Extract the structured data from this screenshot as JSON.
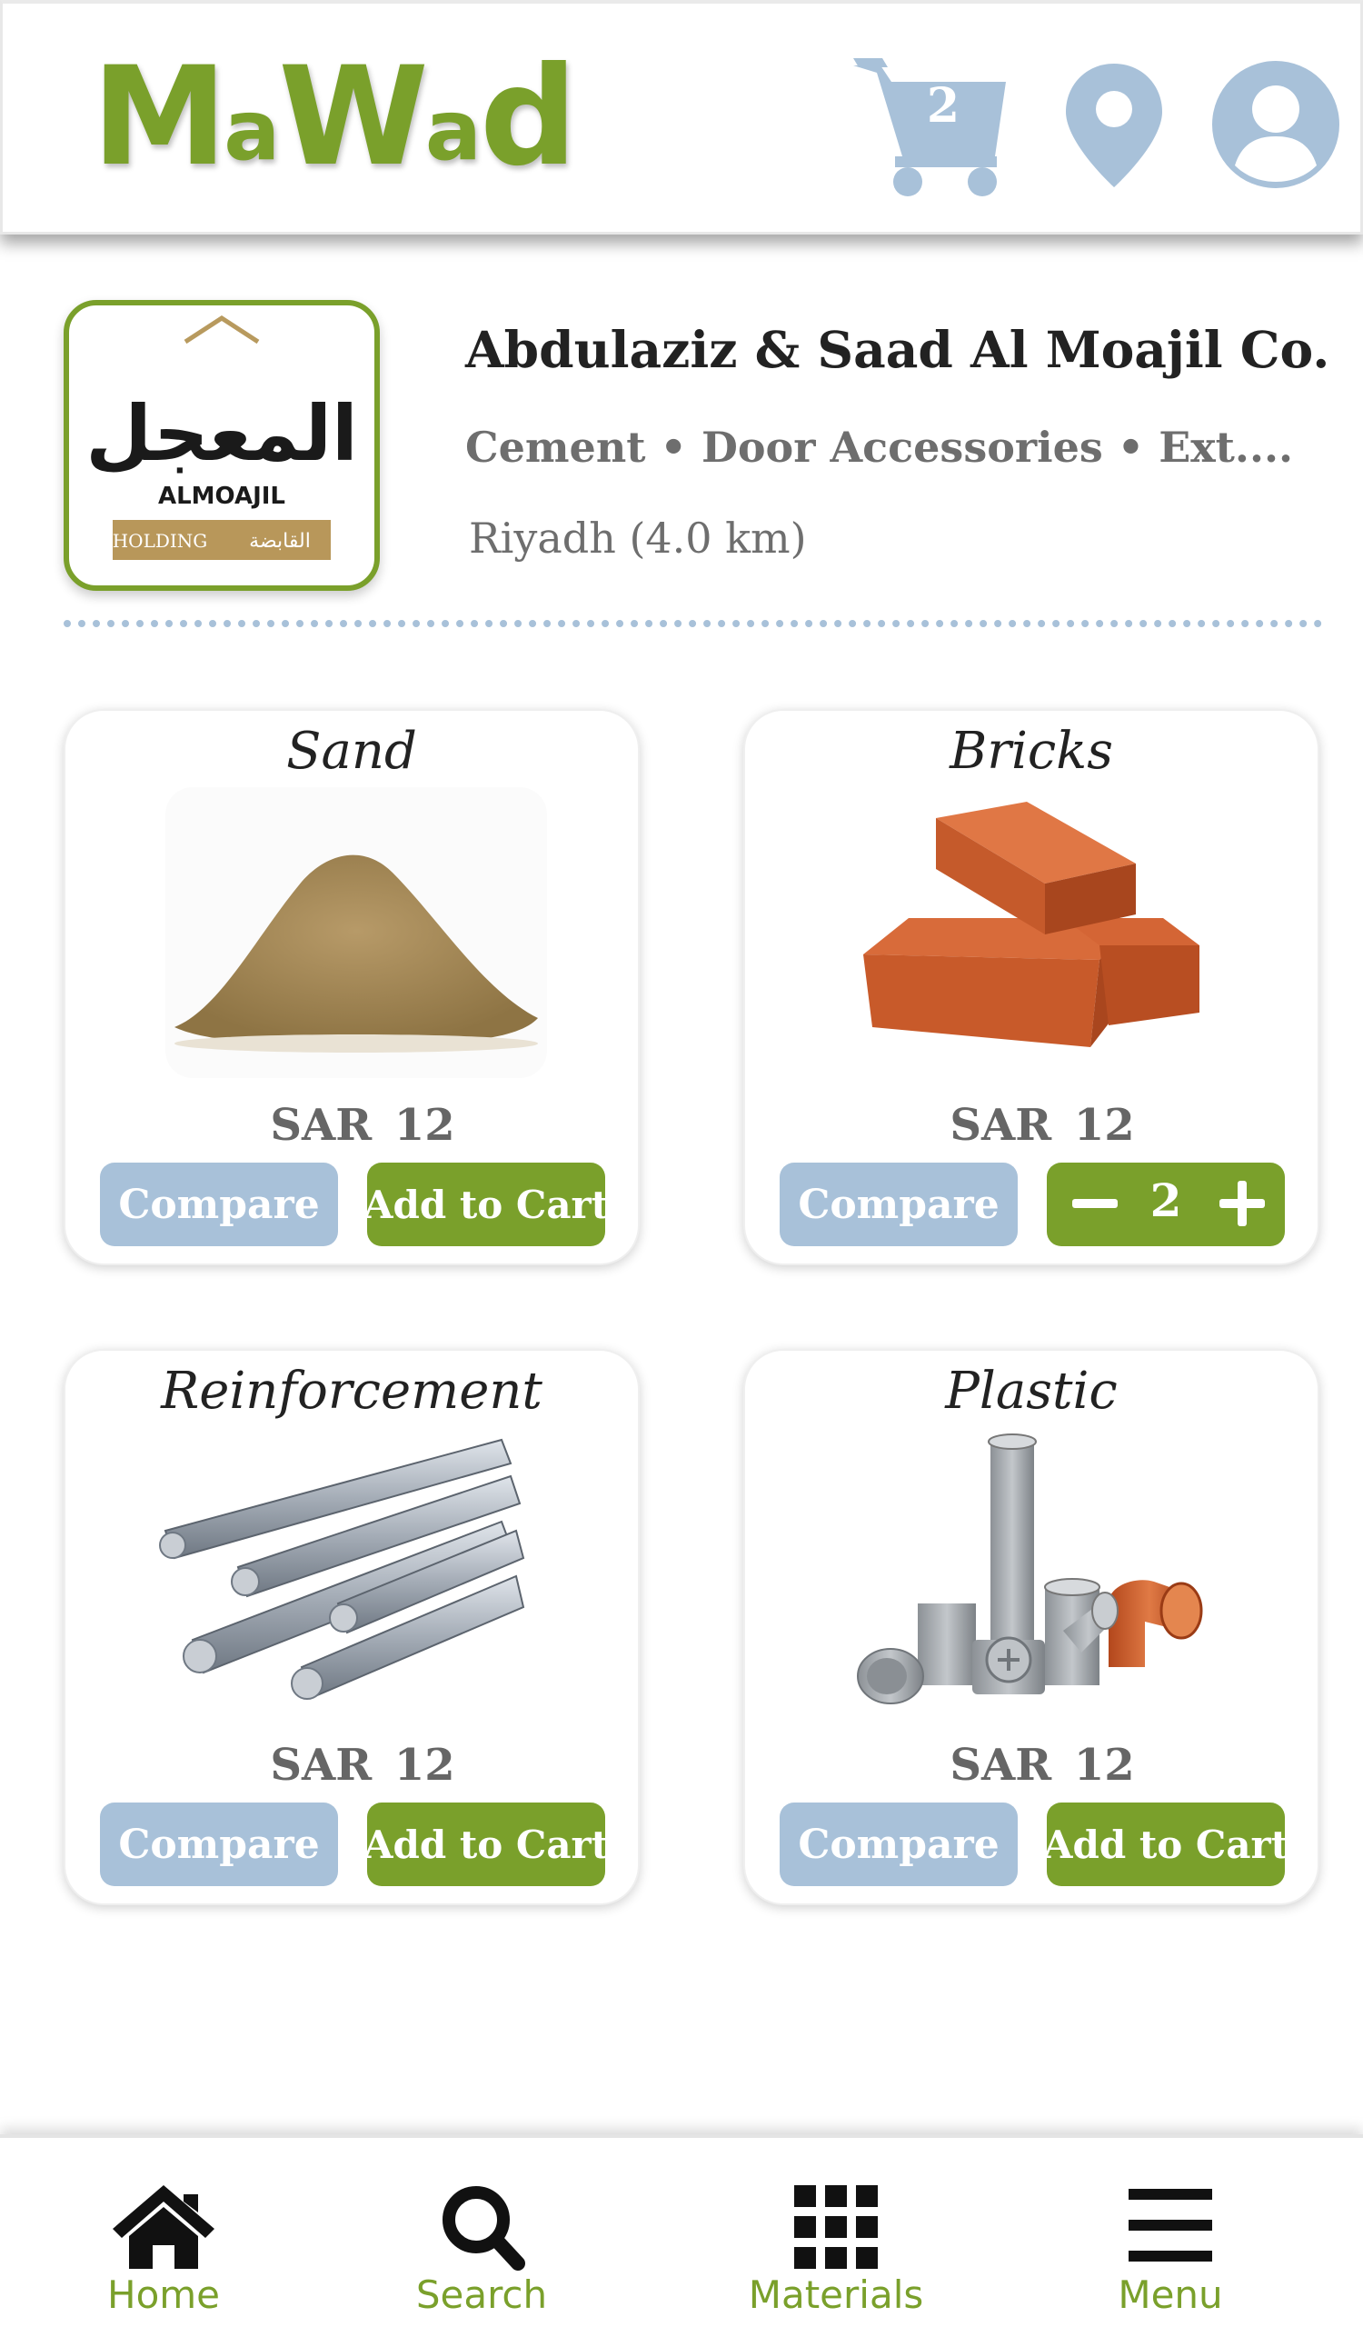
{
  "header": {
    "logo_big_1": "M",
    "logo_small_1": "a",
    "logo_big_2": "W",
    "logo_small_2": "a",
    "logo_big_3": "d",
    "cart_count": "2",
    "icons": [
      "cart-icon",
      "location-pin-icon",
      "user-account-icon"
    ],
    "icon_color": "#a8c1d9",
    "brand_color": "#7aa02b"
  },
  "vendor": {
    "name": "Abdulaziz & Saad Al Moajil Co.",
    "categories": "Cement • Door Accessories • Ext....",
    "location": "Riyadh (4.0 km)",
    "logo_text": "ALMOAJIL",
    "logo_arabic": "المعجل",
    "logo_band_left": "HOLDING",
    "logo_band_right": "القابضة"
  },
  "products": [
    {
      "title": "Sand",
      "price": "SAR 12",
      "compare_label": "Compare",
      "cart_label": "Add to Cart"
    },
    {
      "title": "Bricks",
      "price": "SAR 12",
      "compare_label": "Compare",
      "quantity": "2"
    },
    {
      "title": "Reinforcement",
      "price": "SAR 12",
      "compare_label": "Compare",
      "cart_label": "Add to Cart"
    },
    {
      "title": "Plastic",
      "price": "SAR 12",
      "compare_label": "Compare",
      "cart_label": "Add to Cart"
    }
  ],
  "nav": {
    "items": [
      {
        "label": "Home",
        "icon": "home-icon"
      },
      {
        "label": "Search",
        "icon": "search-icon"
      },
      {
        "label": "Materials",
        "icon": "grid-icon"
      },
      {
        "label": "Menu",
        "icon": "hamburger-menu-icon"
      }
    ]
  }
}
